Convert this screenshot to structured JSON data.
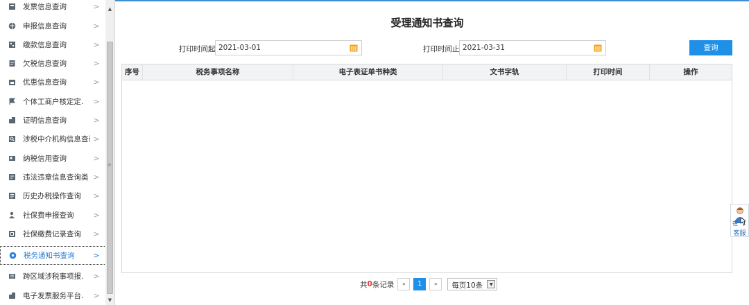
{
  "sidebar": {
    "items": [
      {
        "label": "发票信息查询",
        "icon": "invoice-icon"
      },
      {
        "label": "申报信息查询",
        "icon": "globe-icon"
      },
      {
        "label": "缴款信息查询",
        "icon": "form-icon"
      },
      {
        "label": "欠税信息查询",
        "icon": "document-icon"
      },
      {
        "label": "优惠信息查询",
        "icon": "calendar-icon"
      },
      {
        "label": "个体工商户核定定.",
        "icon": "flag-icon"
      },
      {
        "label": "证明信息查询",
        "icon": "building-icon"
      },
      {
        "label": "涉税中介机构信息查询",
        "icon": "search-doc-icon"
      },
      {
        "label": "纳税信用查询",
        "icon": "id-card-icon"
      },
      {
        "label": "违法违章信息查询类",
        "icon": "warning-doc-icon"
      },
      {
        "label": "历史办税操作查询",
        "icon": "history-icon"
      },
      {
        "label": "社保费申报查询",
        "icon": "user-icon"
      },
      {
        "label": "社保缴费记录查询",
        "icon": "record-icon"
      },
      {
        "label": "税务通知书查询",
        "icon": "location-icon"
      },
      {
        "label": "跨区域涉税事项报.",
        "icon": "cross-region-icon"
      },
      {
        "label": "电子发票服务平台.",
        "icon": "platform-icon"
      }
    ],
    "active_index": 13,
    "chevron": ">"
  },
  "page": {
    "title": "受理通知书查询",
    "start_label": "打印时间起：",
    "start_value": "2021-03-01",
    "end_label": "打印时间止：",
    "end_value": "2021-03-31",
    "query_label": "查询"
  },
  "table": {
    "columns": [
      "序号",
      "税务事项名称",
      "电子表证单书种类",
      "文书字轨",
      "打印时间",
      "操作"
    ],
    "rows": []
  },
  "pagination": {
    "total_prefix": "共",
    "total_count": "0",
    "total_suffix": "条记录",
    "prev": "«",
    "current_page": "1",
    "next": "»",
    "page_size": "每页10条"
  },
  "service_widget": {
    "label": "客服",
    "small_text": "在"
  },
  "colors": {
    "accent": "#1e90e8",
    "calendar": "#f0a21c",
    "total_count": "#e23b3b"
  }
}
